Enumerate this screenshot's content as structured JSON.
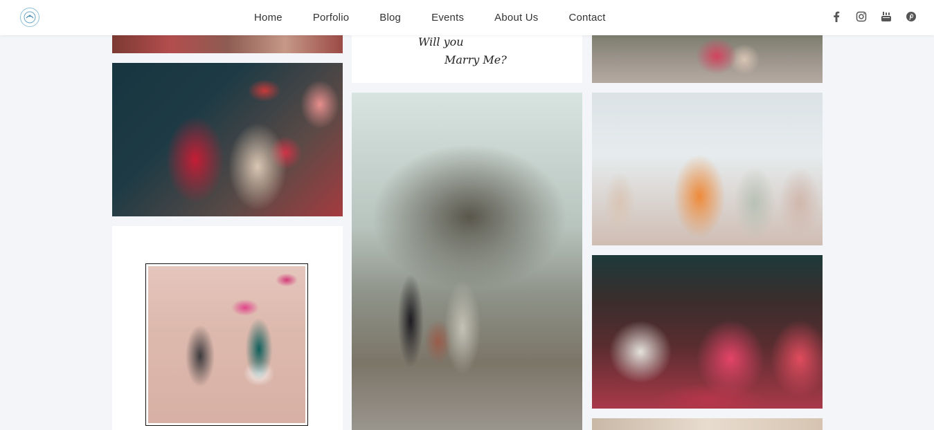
{
  "header": {
    "logo_icon": "logo-icon",
    "nav": [
      {
        "label": "Home"
      },
      {
        "label": "Porfolio"
      },
      {
        "label": "Blog"
      },
      {
        "label": "Events"
      },
      {
        "label": "About Us"
      },
      {
        "label": "Contact"
      }
    ],
    "social": [
      {
        "icon": "facebook-icon"
      },
      {
        "icon": "instagram-icon"
      },
      {
        "icon": "youtube-icon"
      },
      {
        "icon": "pinterest-icon"
      }
    ]
  },
  "gallery": {
    "proposal_card": {
      "line1": "Will you",
      "line2": "Marry Me?"
    }
  },
  "colors": {
    "background": "#f4f5f9",
    "header_bg": "#ffffff",
    "nav_text": "#333333",
    "icon": "#555555"
  }
}
